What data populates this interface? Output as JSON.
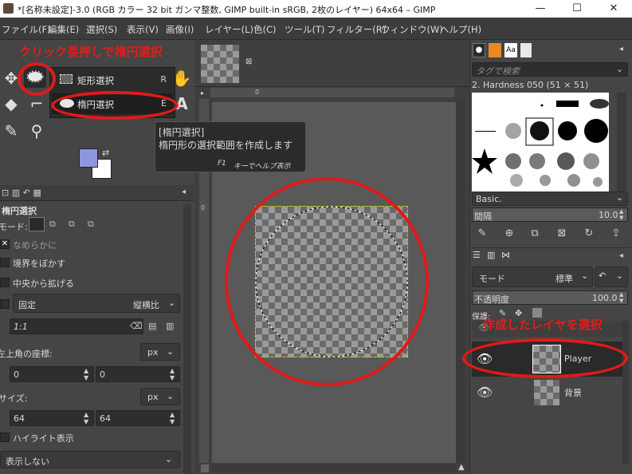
{
  "window": {
    "title": "*[名称未設定]-3.0 (RGB カラー 32 bit ガンマ整数, GIMP built-in sRGB, 2枚のレイヤー) 64x64 – GIMP",
    "minimize": "—",
    "maximize": "☐",
    "close": "✕"
  },
  "menu": [
    "ファイル(F)",
    "編集(E)",
    "選択(S)",
    "表示(V)",
    "画像(I)",
    "レイヤー(L)",
    "色(C)",
    "ツール(T)",
    "フィルター(R)",
    "ウィンドウ(W)",
    "ヘルプ(H)"
  ],
  "annotations": {
    "top": "クリック長押しで楕円選択",
    "layer": "作成したレイヤを選択"
  },
  "tool_popup": {
    "items": [
      {
        "label": "矩形選択",
        "key": "R"
      },
      {
        "label": "楕円選択",
        "key": "E"
      }
    ]
  },
  "tooltip": {
    "title": "[楕円選択]",
    "desc": "楕円形の選択範囲を作成します",
    "help_key": "F1",
    "help_text": "キーでヘルプ表示"
  },
  "tool_options": {
    "title": "楕円選択",
    "mode_label": "モード:",
    "antialias": "なめらかに",
    "feather": "境界をぼかす",
    "expand": "中央から拡げる",
    "fixed_label": "固定",
    "fixed_value": "縦横比",
    "ratio": "1:1",
    "position_label": "左上角の座標:",
    "position_unit": "px",
    "pos_x": "0",
    "pos_y": "0",
    "size_label": "サイズ:",
    "size_unit": "px",
    "size_w": "64",
    "size_h": "64",
    "highlight": "ハイライト表示",
    "guides": "表示しない"
  },
  "rulers": {
    "top_zero": "0",
    "left_zero": "0"
  },
  "brushes": {
    "search_placeholder": "タグで検索",
    "current": "2. Hardness 050 (51 × 51)",
    "preset": "Basic.",
    "spacing_label": "間隔",
    "spacing_value": "10.0"
  },
  "layers": {
    "mode_label": "モード",
    "mode_value": "標準",
    "opacity_label": "不透明度",
    "opacity_value": "100.0",
    "lock_label": "保護:",
    "items": [
      {
        "name": "Player",
        "selected": true
      },
      {
        "name": "背景",
        "selected": false
      }
    ]
  },
  "colors": {
    "fg": "#8d97db",
    "bg": "#ffffff",
    "annotation": "#e01a1a"
  }
}
